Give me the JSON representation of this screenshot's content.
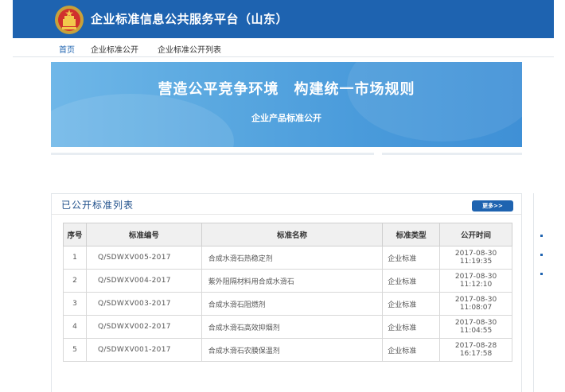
{
  "header": {
    "site_title": "企业标准信息公共服务平台（山东）"
  },
  "nav": {
    "items": [
      "首页",
      "企业标准公开",
      "企业标准公开列表"
    ]
  },
  "banner": {
    "slogan": "营造公平竞争环境　构建统一市场规则",
    "subtitle": "企业产品标准公开"
  },
  "panel": {
    "title": "已公开标准列表",
    "more_label": "更多>>",
    "columns": [
      "序号",
      "标准编号",
      "标准名称",
      "标准类型",
      "公开时间"
    ],
    "rows": [
      {
        "no": "1",
        "code": "Q/SDWXV005-2017",
        "name": "合成水滑石热稳定剂",
        "type": "企业标准",
        "date": "2017-08-30",
        "time": "11:19:35"
      },
      {
        "no": "2",
        "code": "Q/SDWXV004-2017",
        "name": "紫外阻隔材料用合成水滑石",
        "type": "企业标准",
        "date": "2017-08-30",
        "time": "11:12:10"
      },
      {
        "no": "3",
        "code": "Q/SDWXV003-2017",
        "name": "合成水滑石阻燃剂",
        "type": "企业标准",
        "date": "2017-08-30",
        "time": "11:08:07"
      },
      {
        "no": "4",
        "code": "Q/SDWXV002-2017",
        "name": "合成水滑石高效抑烟剂",
        "type": "企业标准",
        "date": "2017-08-30",
        "time": "11:04:55"
      },
      {
        "no": "5",
        "code": "Q/SDWXV001-2017",
        "name": "合成水滑石农膜保温剂",
        "type": "企业标准",
        "date": "2017-08-28",
        "time": "16:17:58"
      }
    ]
  },
  "colors": {
    "brand_blue": "#1e63b0",
    "banner_blue": "#4a9bdb"
  }
}
